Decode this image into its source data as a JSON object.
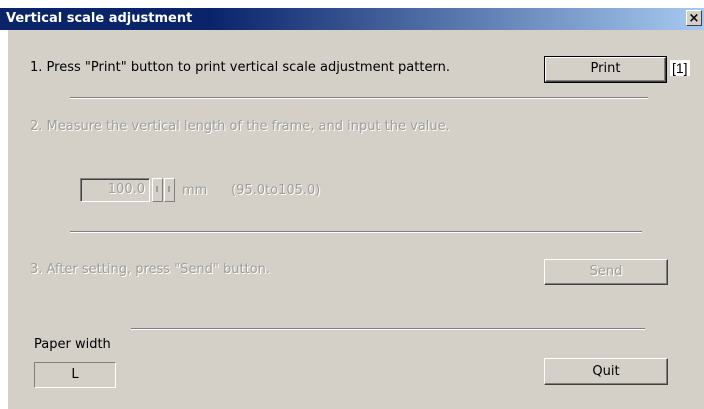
{
  "window": {
    "title": "Vertical scale adjustment",
    "close_glyph": "×"
  },
  "step1": {
    "text": "1. Press \"Print\" button to print vertical scale adjustment pattern.",
    "button_label": "Print",
    "callout": "[1]"
  },
  "step2": {
    "text": "2. Measure the vertical length of the frame, and input the value.",
    "value": "100.0",
    "unit": "mm",
    "range": "(95.0to105.0)"
  },
  "step3": {
    "text": "3. After setting, press \"Send\" button.",
    "button_label": "Send"
  },
  "paper": {
    "label": "Paper width",
    "value": "L"
  },
  "footer": {
    "quit_label": "Quit"
  },
  "colors": {
    "titlebar": "#0a246a",
    "face": "#d4d0c8"
  }
}
